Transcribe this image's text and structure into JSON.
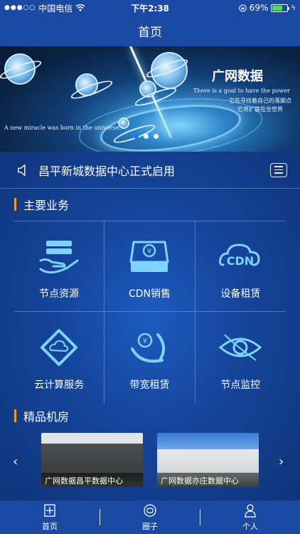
{
  "status_bar": {
    "signal": "●●●○○",
    "carrier": "中国电信",
    "time": "下午2:38",
    "battery_percent": "69%",
    "battery_level": 0.69
  },
  "nav": {
    "title": "首页"
  },
  "banner": {
    "title": "广网数据",
    "tag_en": "There is a goal to have the power",
    "tag_cn1": "它在寻找着自己的落脚点",
    "tag_cn2": "它将扩散在全世界",
    "tagline": "A new miracle was born in the universe.",
    "active_page": 1,
    "page_count": 3
  },
  "announcement": {
    "text": "昌平新城数据中心正式启用"
  },
  "main_services": {
    "title": "主要业务",
    "items": [
      {
        "label": "节点资源",
        "icon": "hand-card-icon"
      },
      {
        "label": "CDN销售",
        "icon": "wallet-yen-icon"
      },
      {
        "label": "设备租赁",
        "icon": "cdn-cloud-icon"
      },
      {
        "label": "云计算服务",
        "icon": "cloud-diamond-icon"
      },
      {
        "label": "带宽租赁",
        "icon": "yen-speed-icon"
      },
      {
        "label": "节点监控",
        "icon": "eye-icon"
      }
    ]
  },
  "premium_rooms": {
    "title": "精品机房",
    "cards": [
      {
        "label": "广网数据昌平数据中心"
      },
      {
        "label": "广网数据亦庄数据中心"
      }
    ],
    "prev": "‹",
    "next": "›"
  },
  "tab_bar": {
    "tabs": [
      {
        "label": "首页",
        "icon": "home-icon"
      },
      {
        "label": "圈子",
        "icon": "circle-icon"
      },
      {
        "label": "个人",
        "icon": "person-icon"
      }
    ]
  },
  "colors": {
    "primary": "#1a4aa4",
    "accent": "#f29a1d",
    "battery": "#4cd964"
  }
}
